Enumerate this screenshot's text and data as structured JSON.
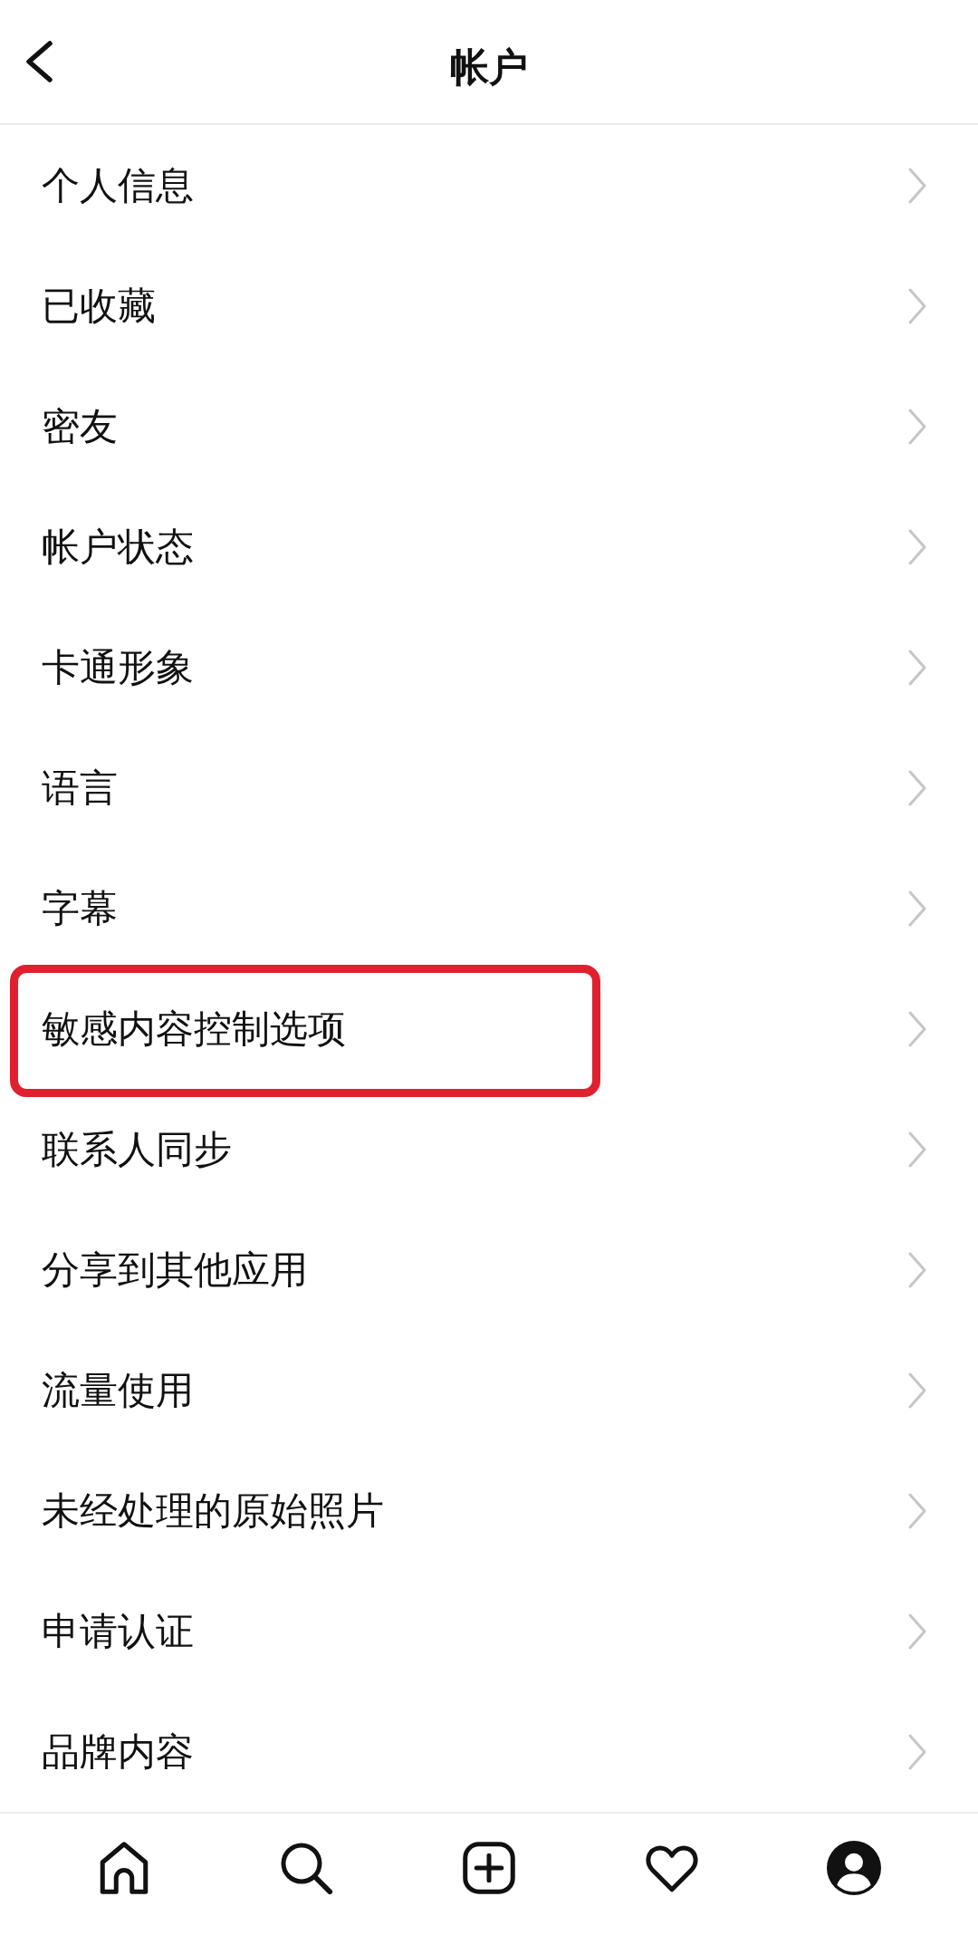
{
  "header": {
    "title": "帐户"
  },
  "items": [
    {
      "label": "个人信息",
      "highlighted": false
    },
    {
      "label": "已收藏",
      "highlighted": false
    },
    {
      "label": "密友",
      "highlighted": false
    },
    {
      "label": "帐户状态",
      "highlighted": false
    },
    {
      "label": "卡通形象",
      "highlighted": false
    },
    {
      "label": "语言",
      "highlighted": false
    },
    {
      "label": "字幕",
      "highlighted": false
    },
    {
      "label": "敏感内容控制选项",
      "highlighted": true
    },
    {
      "label": "联系人同步",
      "highlighted": false
    },
    {
      "label": "分享到其他应用",
      "highlighted": false
    },
    {
      "label": "流量使用",
      "highlighted": false
    },
    {
      "label": "未经处理的原始照片",
      "highlighted": false
    },
    {
      "label": "申请认证",
      "highlighted": false
    },
    {
      "label": "品牌内容",
      "highlighted": false
    }
  ],
  "bottom_nav": [
    {
      "kind": "home"
    },
    {
      "kind": "search"
    },
    {
      "kind": "create"
    },
    {
      "kind": "activity"
    },
    {
      "kind": "profile"
    }
  ]
}
